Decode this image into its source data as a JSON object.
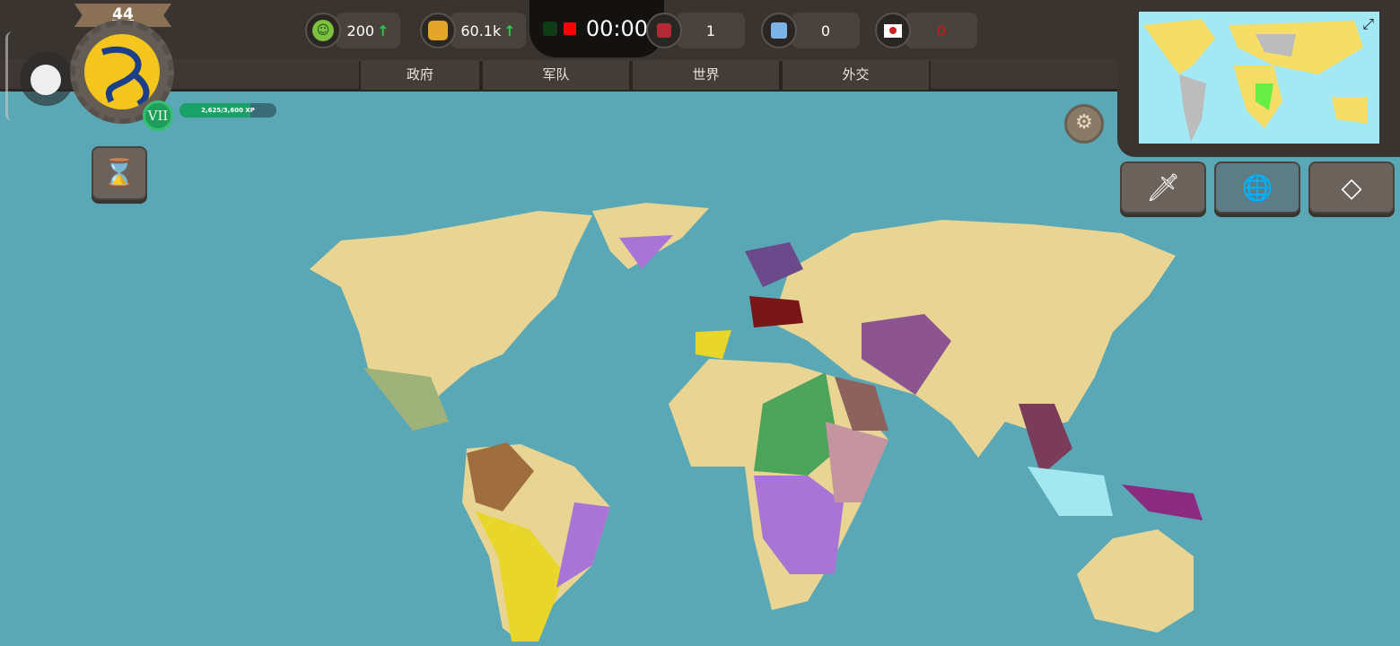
{
  "player": {
    "level": "44",
    "rank": "VII",
    "xp_text": "2,625/3,600 XP",
    "xp_fraction": 0.729
  },
  "stats": {
    "happiness": "200",
    "money": "60.1k",
    "timer": "00:00",
    "red_count": "1",
    "blue_count": "0",
    "flag_count": "0"
  },
  "tabs": [
    "政府",
    "军队",
    "世界",
    "外交"
  ],
  "colors": {
    "ocean": "#5aa7b6",
    "land": "#e8d594",
    "topbar": "#3a3431"
  }
}
